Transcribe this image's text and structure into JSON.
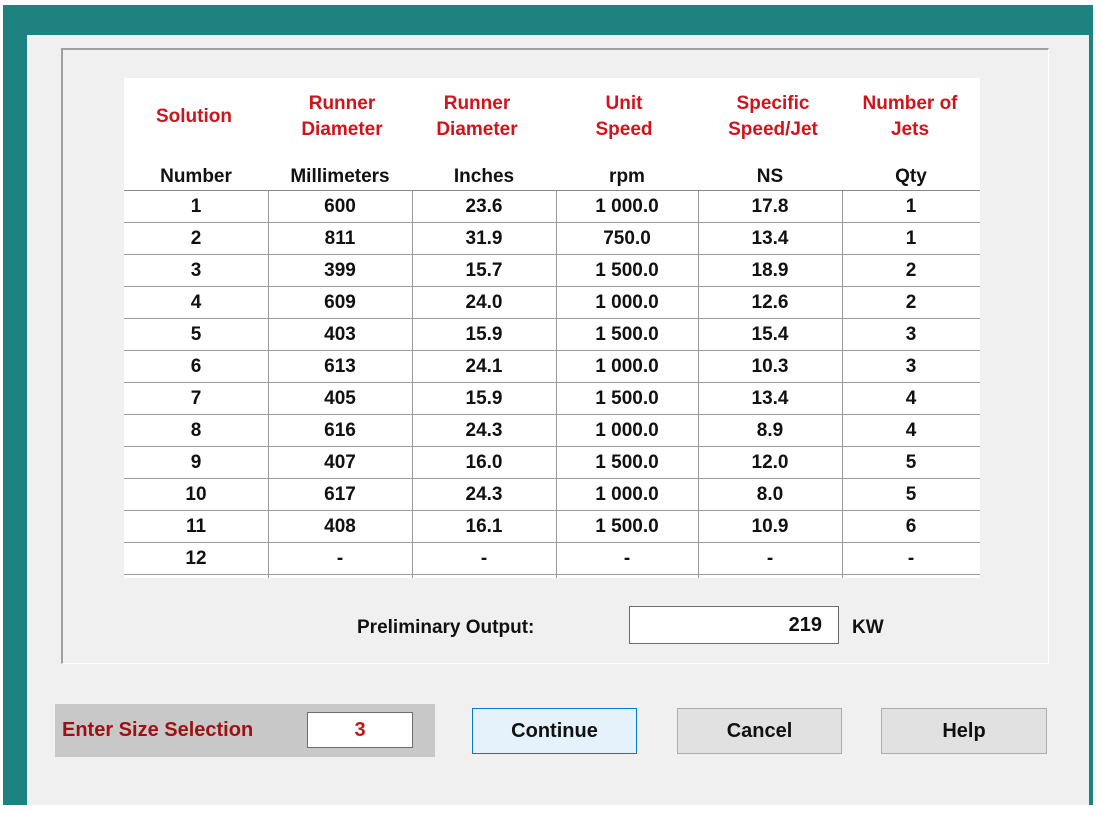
{
  "columns": [
    {
      "header": "Solution",
      "unit": "Number"
    },
    {
      "header": "Runner\nDiameter",
      "unit": "Millimeters"
    },
    {
      "header": "Runner\nDiameter",
      "unit": "Inches"
    },
    {
      "header": "Unit\nSpeed",
      "unit": "rpm"
    },
    {
      "header": "Specific\nSpeed/Jet",
      "unit": "NS"
    },
    {
      "header": "Number of\nJets",
      "unit": "Qty"
    }
  ],
  "rows": [
    [
      "1",
      "600",
      "23.6",
      "1 000.0",
      "17.8",
      "1"
    ],
    [
      "2",
      "811",
      "31.9",
      "750.0",
      "13.4",
      "1"
    ],
    [
      "3",
      "399",
      "15.7",
      "1 500.0",
      "18.9",
      "2"
    ],
    [
      "4",
      "609",
      "24.0",
      "1 000.0",
      "12.6",
      "2"
    ],
    [
      "5",
      "403",
      "15.9",
      "1 500.0",
      "15.4",
      "3"
    ],
    [
      "6",
      "613",
      "24.1",
      "1 000.0",
      "10.3",
      "3"
    ],
    [
      "7",
      "405",
      "15.9",
      "1 500.0",
      "13.4",
      "4"
    ],
    [
      "8",
      "616",
      "24.3",
      "1 000.0",
      "8.9",
      "4"
    ],
    [
      "9",
      "407",
      "16.0",
      "1 500.0",
      "12.0",
      "5"
    ],
    [
      "10",
      "617",
      "24.3",
      "1 000.0",
      "8.0",
      "5"
    ],
    [
      "11",
      "408",
      "16.1",
      "1 500.0",
      "10.9",
      "6"
    ],
    [
      "12",
      "-",
      "-",
      "-",
      "-",
      "-"
    ]
  ],
  "preliminary": {
    "label": "Preliminary Output:",
    "value": "219",
    "unit": "KW"
  },
  "selection": {
    "label": "Enter Size Selection",
    "value": "3"
  },
  "buttons": {
    "continue": "Continue",
    "cancel": "Cancel",
    "help": "Help"
  },
  "colors": {
    "frame": "#1e8280",
    "header_text": "#d0141c",
    "selection_label": "#9c1212"
  }
}
